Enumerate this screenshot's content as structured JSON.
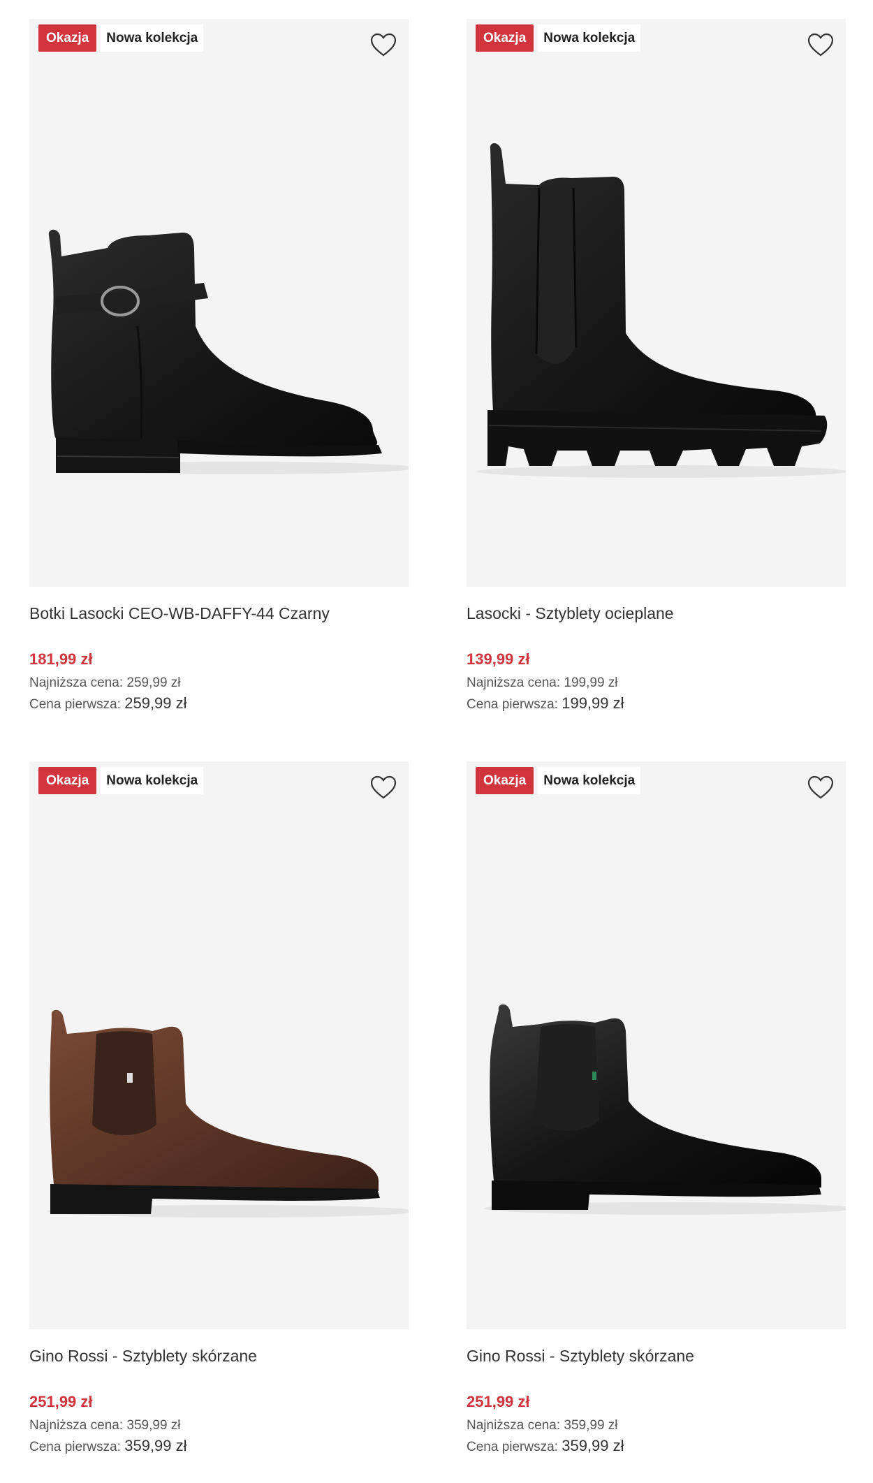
{
  "products": [
    {
      "badge_sale": "Okazja",
      "badge_new": "Nowa kolekcja",
      "image_icon": "black-buckle-ankle-boot",
      "name": "Botki Lasocki CEO-WB-DAFFY-44 Czarny",
      "price": "181,99 zł",
      "lowest_label": "Najniższa cena:",
      "lowest_value": "259,99 zł",
      "first_label": "Cena pierwsza:",
      "first_value": "259,99 zł"
    },
    {
      "badge_sale": "Okazja",
      "badge_new": "Nowa kolekcja",
      "image_icon": "black-chunky-chelsea-boot",
      "name": "Lasocki - Sztyblety ocieplane",
      "price": "139,99 zł",
      "lowest_label": "Najniższa cena:",
      "lowest_value": "199,99 zł",
      "first_label": "Cena pierwsza:",
      "first_value": "199,99 zł"
    },
    {
      "badge_sale": "Okazja",
      "badge_new": "Nowa kolekcja",
      "image_icon": "brown-chelsea-boot",
      "name": "Gino Rossi - Sztyblety skórzane",
      "price": "251,99 zł",
      "lowest_label": "Najniższa cena:",
      "lowest_value": "359,99 zł",
      "first_label": "Cena pierwsza:",
      "first_value": "359,99 zł"
    },
    {
      "badge_sale": "Okazja",
      "badge_new": "Nowa kolekcja",
      "image_icon": "black-chelsea-boot",
      "name": "Gino Rossi - Sztyblety skórzane",
      "price": "251,99 zł",
      "lowest_label": "Najniższa cena:",
      "lowest_value": "359,99 zł",
      "first_label": "Cena pierwsza:",
      "first_value": "359,99 zł"
    }
  ],
  "colors": {
    "sale": "#d1343c",
    "image_bg": "#f4f4f4",
    "brown_leather": "#5a3425",
    "black_leather": "#1b1b1b"
  }
}
